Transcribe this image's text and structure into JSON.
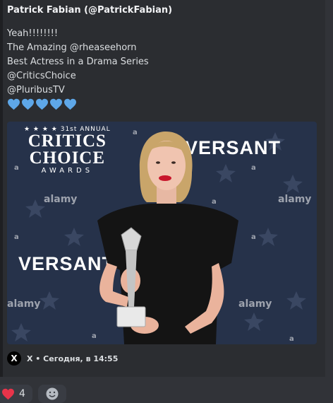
{
  "embed": {
    "author": "Patrick Fabian (@PatrickFabian)",
    "lines": [
      "Yeah!!!!!!!!",
      "The Amazing @rheaseehorn",
      "Best Actress in a Drama Series",
      "@CriticsChoice",
      "@PluribusTV"
    ],
    "heart_icons": [
      "blue-heart-icon",
      "blue-heart-icon",
      "blue-heart-icon",
      "blue-heart-icon",
      "blue-heart-icon"
    ],
    "heart_color": "#5ea7e8"
  },
  "photo": {
    "logo_number": "31st",
    "logo_top": "ANNUAL",
    "logo_line1": "CRITICS",
    "logo_line2": "CHOICE",
    "logo_line3": "AWARDS",
    "brand": "VERSANT",
    "watermark": "alamy",
    "watermark_letter": "a",
    "background_color": "#26324a"
  },
  "footer": {
    "source_icon": "x-logo-icon",
    "source_glyph": "X",
    "text": "X • Сегодня, в 14:55"
  },
  "reactions": {
    "heart": {
      "icon": "red-heart-icon",
      "count": "4"
    },
    "add_icon": "add-reaction-icon"
  }
}
